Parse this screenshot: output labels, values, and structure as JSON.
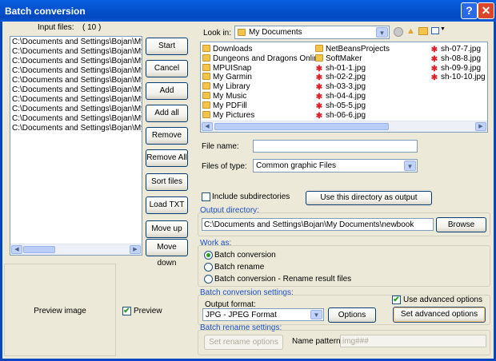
{
  "window": {
    "title": "Batch conversion",
    "help_label": "?",
    "close_label": "✕"
  },
  "input": {
    "label": "Input files:",
    "count": "( 10 )",
    "files": [
      "C:\\Documents and Settings\\Bojan\\My Do",
      "C:\\Documents and Settings\\Bojan\\My Do",
      "C:\\Documents and Settings\\Bojan\\My Do",
      "C:\\Documents and Settings\\Bojan\\My Do",
      "C:\\Documents and Settings\\Bojan\\My Do",
      "C:\\Documents and Settings\\Bojan\\My Do",
      "C:\\Documents and Settings\\Bojan\\My Do",
      "C:\\Documents and Settings\\Bojan\\My Do",
      "C:\\Documents and Settings\\Bojan\\My Do",
      "C:\\Documents and Settings\\Bojan\\My Do"
    ]
  },
  "buttons": {
    "start": "Start",
    "cancel": "Cancel",
    "add": "Add",
    "add_all": "Add all",
    "remove": "Remove",
    "remove_all": "Remove All",
    "sort": "Sort files",
    "load_txt": "Load TXT",
    "move_up": "Move up",
    "move_down": "Move down"
  },
  "preview": {
    "image_label": "Preview image",
    "checkbox_label": "Preview",
    "checked": true
  },
  "browser": {
    "look_in_label": "Look in:",
    "look_in_value": "My Documents",
    "col1": [
      {
        "name": "Downloads",
        "icon": "folder-icon"
      },
      {
        "name": "Dungeons and Dragons Online",
        "icon": "folder-icon"
      },
      {
        "name": "MPUISnap",
        "icon": "folder-icon"
      },
      {
        "name": "My Garmin",
        "icon": "folder-icon"
      },
      {
        "name": "My Library",
        "icon": "folder-icon"
      },
      {
        "name": "My Music",
        "icon": "folder-icon"
      },
      {
        "name": "My PDFill",
        "icon": "folder-icon"
      },
      {
        "name": "My Pictures",
        "icon": "folder-icon"
      }
    ],
    "col2": [
      {
        "name": "NetBeansProjects",
        "icon": "folder-icon"
      },
      {
        "name": "SoftMaker",
        "icon": "folder-icon"
      },
      {
        "name": "sh-01-1.jpg",
        "icon": "image-file-icon"
      },
      {
        "name": "sh-02-2.jpg",
        "icon": "image-file-icon"
      },
      {
        "name": "sh-03-3.jpg",
        "icon": "image-file-icon"
      },
      {
        "name": "sh-04-4.jpg",
        "icon": "image-file-icon"
      },
      {
        "name": "sh-05-5.jpg",
        "icon": "image-file-icon"
      },
      {
        "name": "sh-06-6.jpg",
        "icon": "image-file-icon"
      }
    ],
    "col3": [
      {
        "name": "sh-07-7.jpg",
        "icon": "image-file-icon"
      },
      {
        "name": "sh-08-8.jpg",
        "icon": "image-file-icon"
      },
      {
        "name": "sh-09-9.jpg",
        "icon": "image-file-icon"
      },
      {
        "name": "sh-10-10.jpg",
        "icon": "image-file-icon"
      }
    ],
    "file_name_label": "File name:",
    "file_name_value": "",
    "files_of_type_label": "Files of type:",
    "files_of_type_value": "Common graphic Files",
    "include_subdirs_label": "Include subdirectories",
    "use_dir_button": "Use this directory as output"
  },
  "output": {
    "section_label": "Output directory:",
    "path": "C:\\Documents and Settings\\Bojan\\My Documents\\newbook",
    "browse_button": "Browse"
  },
  "work_as": {
    "section_label": "Work as:",
    "options": [
      "Batch conversion",
      "Batch rename",
      "Batch conversion - Rename result files"
    ],
    "selected_index": 0
  },
  "conversion": {
    "section_label": "Batch conversion settings:",
    "output_format_label": "Output format:",
    "output_format_value": "JPG - JPEG Format",
    "options_button": "Options",
    "use_advanced_label": "Use advanced options",
    "use_advanced_checked": true,
    "set_advanced_button": "Set advanced options"
  },
  "rename": {
    "section_label": "Batch rename settings:",
    "set_rename_button": "Set rename options",
    "name_pattern_label": "Name pattern:",
    "name_pattern_value": "img###"
  },
  "colors": {
    "title_bar": "#0453d0",
    "section_label": "#1a4ec9",
    "image_icon": "#e0202a",
    "folder_icon": "#f2c44a"
  }
}
